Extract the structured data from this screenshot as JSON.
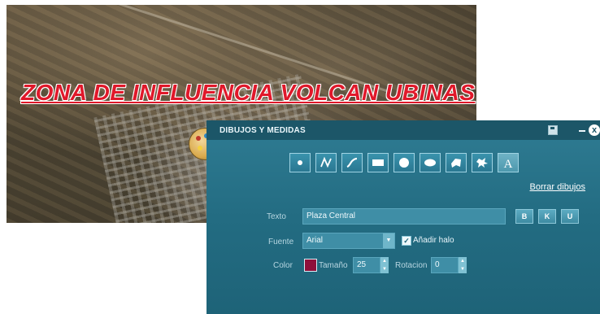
{
  "map": {
    "title": "ZONA DE INFLUENCIA VOLCAN UBINAS"
  },
  "dialog": {
    "title": "DIBUJOS Y MEDIDAS",
    "close_glyph": "x",
    "tools": [
      {
        "name": "point-tool",
        "icon": "point-icon"
      },
      {
        "name": "line-tool",
        "icon": "polyline-icon"
      },
      {
        "name": "freehand-tool",
        "icon": "freehand-icon"
      },
      {
        "name": "rectangle-tool",
        "icon": "rectangle-icon"
      },
      {
        "name": "circle-tool",
        "icon": "circle-icon"
      },
      {
        "name": "ellipse-tool",
        "icon": "ellipse-icon"
      },
      {
        "name": "polygon-tool",
        "icon": "polygon-icon"
      },
      {
        "name": "freehand-polygon-tool",
        "icon": "freehand-polygon-icon"
      },
      {
        "name": "text-tool",
        "icon": "text-icon",
        "active": true
      }
    ],
    "clear_link": "Borrar dibujos",
    "labels": {
      "texto": "Texto",
      "fuente": "Fuente",
      "color": "Color",
      "tamano": "Tamaño",
      "rotacion": "Rotacion",
      "halo": "Añadir halo"
    },
    "text_value": "Plaza Central",
    "format_buttons": {
      "bold": "B",
      "italic": "K",
      "underline": "U"
    },
    "font_value": "Arial",
    "halo_checked": true,
    "color_value": "#8e0f3a",
    "size_value": "25",
    "rotation_value": "0"
  }
}
